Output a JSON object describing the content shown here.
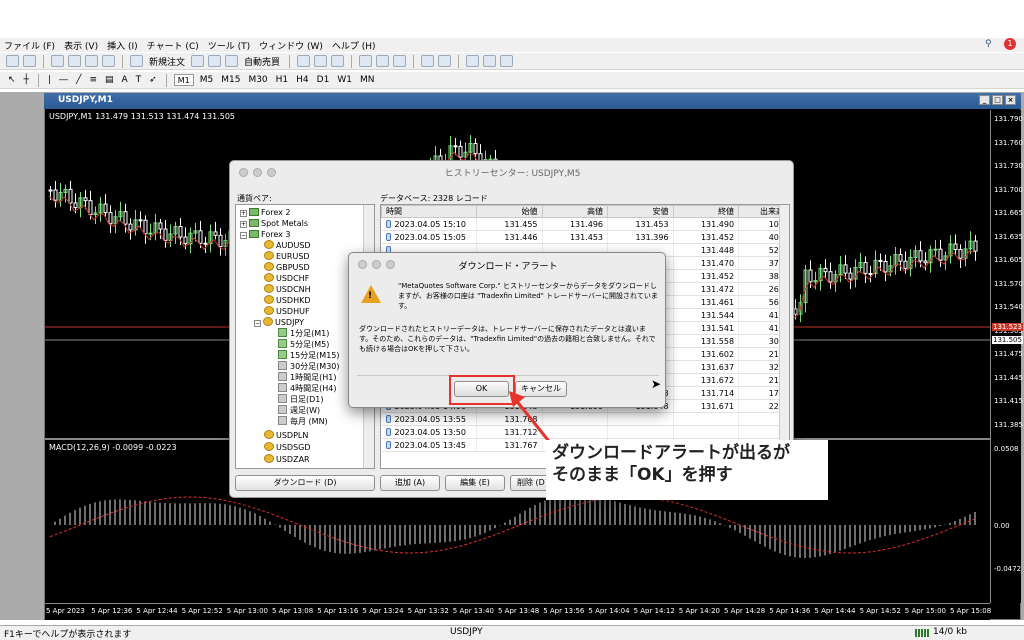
{
  "menu": [
    "ファイル (F)",
    "表示 (V)",
    "挿入 (I)",
    "チャート (C)",
    "ツール (T)",
    "ウィンドウ (W)",
    "ヘルプ (H)"
  ],
  "toolbar": {
    "new_order": "新規注文",
    "autotrade": "自動売買",
    "timeframes": [
      "M1",
      "M5",
      "M15",
      "M30",
      "H1",
      "H4",
      "D1",
      "W1",
      "MN"
    ]
  },
  "chart": {
    "title": "USDJPY,M1",
    "info": "USDJPY,M1  131.479 131.513 131.474 131.505",
    "macd": "MACD(12,26,9) -0.0099 -0.0223",
    "prices": [
      "131.790",
      "131.760",
      "131.730",
      "131.700",
      "131.665",
      "131.635",
      "131.605",
      "131.570",
      "131.540",
      "131.505",
      "131.475",
      "131.445",
      "131.415",
      "131.385"
    ],
    "price_mark_red": "131.523",
    "price_mark": "131.505",
    "macd_scale": [
      "0.0508",
      "0.00",
      "-0.0472"
    ],
    "times": [
      "5 Apr 2023",
      "5 Apr 12:36",
      "5 Apr 12:44",
      "5 Apr 12:52",
      "5 Apr 13:00",
      "5 Apr 13:08",
      "5 Apr 13:16",
      "5 Apr 13:24",
      "5 Apr 13:32",
      "5 Apr 13:40",
      "5 Apr 13:48",
      "5 Apr 13:56",
      "5 Apr 14:04",
      "5 Apr 14:12",
      "5 Apr 14:20",
      "5 Apr 14:28",
      "5 Apr 14:36",
      "5 Apr 14:44",
      "5 Apr 14:52",
      "5 Apr 15:00",
      "5 Apr 15:08"
    ]
  },
  "history": {
    "title": "ヒストリーセンター: USDJPY,M5",
    "tree_label": "通貨ペア:",
    "db_label": "データベース: 2328 レコード",
    "tree": [
      "Forex 2",
      "Spot Metals",
      "Forex 3",
      "AUDUSD",
      "EURUSD",
      "GBPUSD",
      "USDCHF",
      "USDCNH",
      "USDHKD",
      "USDHUF",
      "USDJPY",
      "1分足(M1)",
      "5分足(M5)",
      "15分足(M15)",
      "30分足(M30)",
      "1時間足(H1)",
      "4時間足(H4)",
      "日足(D1)",
      "週足(W)",
      "毎月 (MN)",
      "USDPLN",
      "USDSGD",
      "USDZAR"
    ],
    "columns": [
      "時間",
      "始値",
      "高値",
      "安値",
      "終値",
      "出来高"
    ],
    "rows": [
      [
        "2023.04.05 15:10",
        "131.455",
        "131.496",
        "131.453",
        "131.490",
        "106"
      ],
      [
        "2023.04.05 15:05",
        "131.446",
        "131.453",
        "131.396",
        "131.452",
        "408"
      ],
      [
        "",
        "",
        "",
        "",
        "131.448",
        "526"
      ],
      [
        "",
        "",
        "",
        "",
        "131.470",
        "374"
      ],
      [
        "",
        "",
        "",
        "",
        "131.452",
        "382"
      ],
      [
        "",
        "",
        "",
        "",
        "131.472",
        "267"
      ],
      [
        "",
        "",
        "",
        "",
        "131.461",
        "562"
      ],
      [
        "",
        "",
        "",
        "",
        "131.544",
        "410"
      ],
      [
        "",
        "",
        "",
        "",
        "131.541",
        "417"
      ],
      [
        "",
        "",
        "",
        "",
        "131.558",
        "306"
      ],
      [
        "",
        "",
        "",
        "",
        "131.602",
        "218"
      ],
      [
        "",
        "",
        "",
        "",
        "131.637",
        "327"
      ],
      [
        "",
        "",
        "",
        "",
        "131.672",
        "217"
      ],
      [
        "2023.04.05 14:05",
        "131.572",
        "131.717",
        "131.653",
        "131.714",
        "172"
      ],
      [
        "2023.04.05 14:00",
        "131.648",
        "131.690",
        "131.648",
        "131.671",
        "222"
      ],
      [
        "2023.04.05 13:55",
        "131.708",
        "",
        "",
        "",
        ""
      ],
      [
        "2023.04.05 13:50",
        "131.712",
        "",
        "",
        "",
        ""
      ],
      [
        "2023.04.05 13:45",
        "131.767",
        "",
        "",
        "",
        ""
      ]
    ],
    "buttons": {
      "download": "ダウンロード (D)",
      "add": "追加 (A)",
      "edit": "編集 (E)",
      "delete": "削除 (D)"
    }
  },
  "alert": {
    "title": "ダウンロード・アラート",
    "msg1": "\"MetaQuotes Software Corp.\" ヒストリーセンターからデータをダウンロードしますが、お客様の口座は \"Tradexfin Limited\" トレードサーバーに開設されています。",
    "msg2": "ダウンロードされたヒストリーデータは、トレードサーバーに保存されたデータとは違います。そのため、これらのデータは、\"Tradexfin Limited\"の過去の籍相と合致しません。それでも続ける場合はOKを押して下さい。",
    "ok": "OK",
    "cancel": "キャンセル"
  },
  "callout": {
    "line1": "ダウンロードアラートが出るが",
    "line2": "そのまま「OK」を押す"
  },
  "status": {
    "help": "F1キーでヘルプが表示されます",
    "symbol": "USDJPY",
    "traffic": "14/0 kb"
  },
  "colors": {
    "highlight": "#e8322c",
    "bull": "#7fe07f",
    "bear": "#ffffff",
    "ma": "#c0392b"
  }
}
